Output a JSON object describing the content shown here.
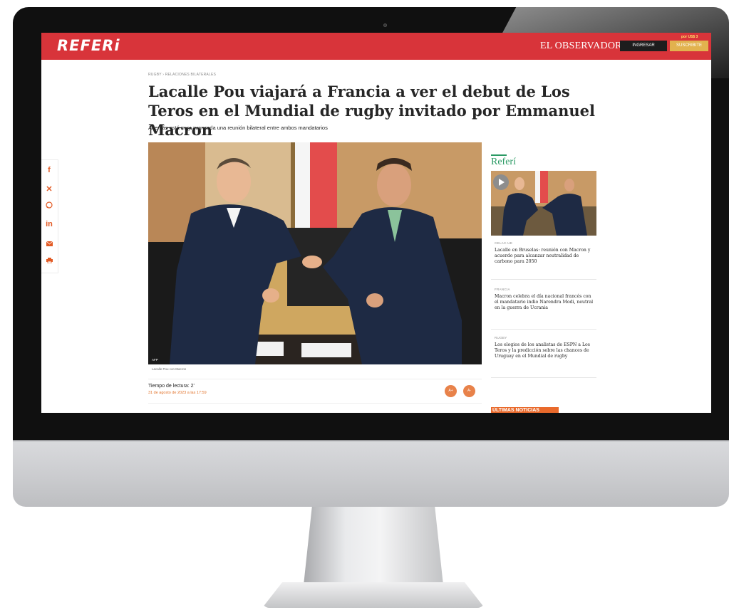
{
  "header": {
    "logo": "REFERi",
    "publisher": "EL OBSERVADOR",
    "login_label": "INGRESAR",
    "subscribe_label": "SUSCRIBITE",
    "promo": "por US$ 3"
  },
  "share": {
    "icons": [
      "facebook-icon",
      "x-icon",
      "whatsapp-icon",
      "linkedin-icon",
      "email-icon",
      "print-icon"
    ]
  },
  "article": {
    "breadcrumb": "RUGBY › RELACIONES BILATERALES",
    "headline": "Lacalle Pou viajará a Francia a ver el debut de Los Teros en el Mundial de rugby invitado por Emmanuel Macron",
    "subheadline": "Además está muy avanzada una reunión bilateral entre ambos mandatarios",
    "image_credit": "AFP",
    "image_caption": "Lacalle Pou con Macron",
    "reading_time": "Tiempo de lectura: 2'",
    "date": "31 de agosto de 2023 a las 17:59",
    "font_increase": "A+",
    "font_decrease": "A-"
  },
  "sidebar": {
    "brand": "Referí",
    "items": [
      {
        "category": "CELAC-UE",
        "title": "Lacalle en Bruselas: reunión con Macron y acuerdo para alcanzar neutralidad de carbono para 2050"
      },
      {
        "category": "FRANCIA",
        "title": "Macron celebra el día nacional francés con el mandatario indio Narendra Modi, neutral en la guerra de Ucrania"
      },
      {
        "category": "RUGBY",
        "title": "Los elogios de los analistas de ESPN a Los Teros y la predicción sobre las chances de Uruguay en el Mundial de rugby"
      }
    ],
    "latest_label": "ÚLTIMAS NOTICIAS"
  },
  "colors": {
    "header_red": "#d8343a",
    "accent_orange": "#e2742d",
    "referi_green": "#2a9a64",
    "subscribe_gold": "#e2b24e"
  }
}
